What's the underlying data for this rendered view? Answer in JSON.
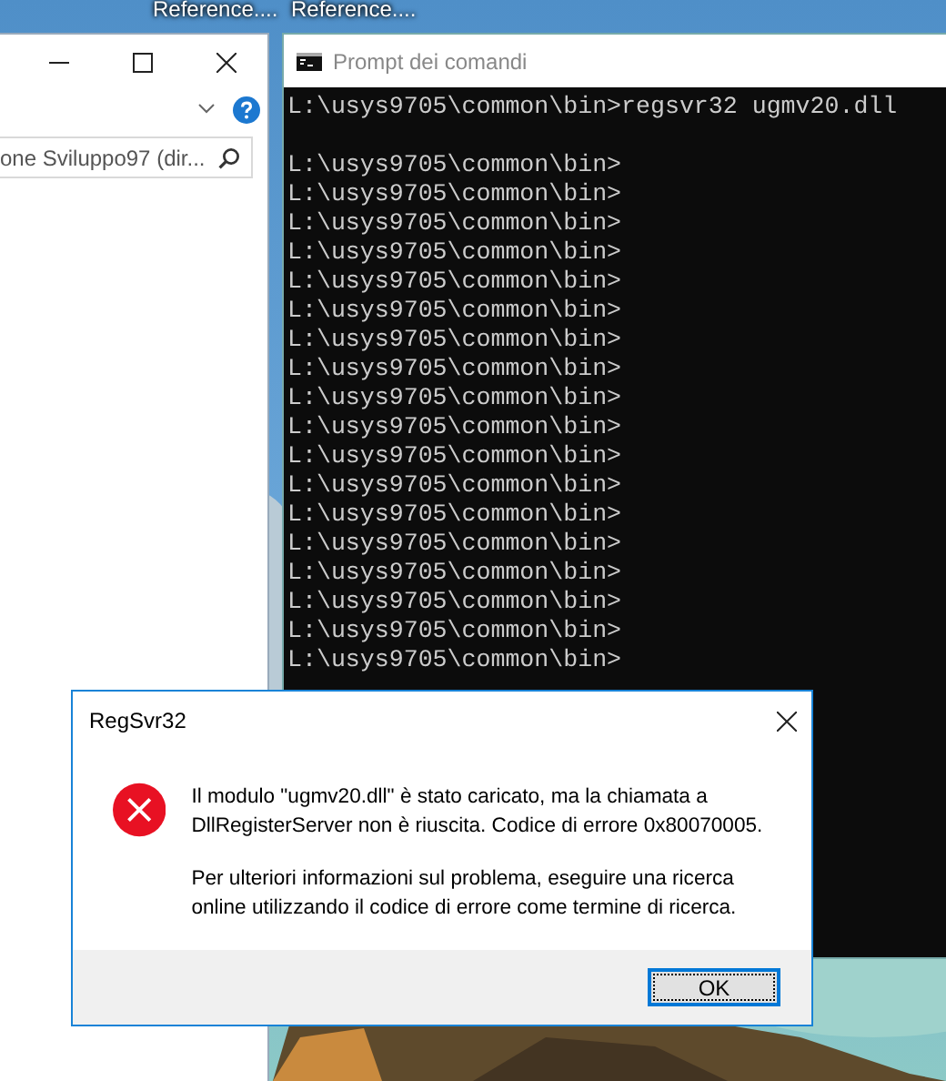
{
  "taskbar_labels": [
    "Reference....",
    "Reference...."
  ],
  "explorer": {
    "search": {
      "value": "one Sviluppo97 (dir..."
    }
  },
  "console": {
    "title": "Prompt dei comandi",
    "blocks": [
      [
        "L:\\usys9705\\common\\bin>regsvr32 ugmv20.dll"
      ],
      [
        "L:\\usys9705\\common\\bin>",
        "L:\\usys9705\\common\\bin>",
        "L:\\usys9705\\common\\bin>",
        "L:\\usys9705\\common\\bin>",
        "L:\\usys9705\\common\\bin>",
        "L:\\usys9705\\common\\bin>",
        "L:\\usys9705\\common\\bin>",
        "L:\\usys9705\\common\\bin>",
        "L:\\usys9705\\common\\bin>",
        "L:\\usys9705\\common\\bin>",
        "L:\\usys9705\\common\\bin>",
        "L:\\usys9705\\common\\bin>",
        "L:\\usys9705\\common\\bin>",
        "L:\\usys9705\\common\\bin>",
        "L:\\usys9705\\common\\bin>",
        "L:\\usys9705\\common\\bin>",
        "L:\\usys9705\\common\\bin>",
        "L:\\usys9705\\common\\bin>"
      ]
    ]
  },
  "dialog": {
    "title": "RegSvr32",
    "messages": [
      "Il modulo \"ugmv20.dll\" è stato caricato, ma la chiamata a DllRegisterServer non è riuscita. Codice di errore 0x80070005.",
      "Per ulteriori informazioni sul problema, eseguire una ricerca online utilizzando il codice di errore come termine di ricerca."
    ],
    "buttons": [
      {
        "label": "OK",
        "default": true
      }
    ]
  }
}
